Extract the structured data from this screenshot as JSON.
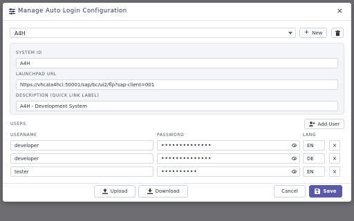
{
  "dialog": {
    "title": "Manage Auto Login Configuration",
    "close_glyph": "×",
    "menu_icon": "list-icon"
  },
  "system_select": {
    "value": "A4H"
  },
  "toolbar": {
    "new_label": "New",
    "new_glyph": "+",
    "delete_icon": "trash-icon"
  },
  "system": {
    "id_label": "SYSTEM ID",
    "id_value": "A4H",
    "url_label": "LAUNCHPAD URL",
    "url_value": "https://vhcala4hci:50001/sap/bc/ui2/flp?sap-client=001",
    "desc_label": "DESCRIPTION (QUICK LINK LABEL)",
    "desc_value": "A4H - Development System"
  },
  "users": {
    "section_label": "USERS",
    "add_label": "Add User",
    "col_username": "USERNAME",
    "col_password": "PASSWORD",
    "col_lang": "LANG",
    "rows": [
      {
        "username": "developer",
        "password": "••••••••••••••",
        "lang": "EN"
      },
      {
        "username": "developer",
        "password": "••••••••••••••",
        "lang": "DE"
      },
      {
        "username": "tester",
        "password": "••••••••••",
        "lang": "EN"
      }
    ],
    "remove_glyph": "×"
  },
  "footer": {
    "upload_label": "Upload",
    "download_label": "Download",
    "cancel_label": "Cancel",
    "save_label": "Save"
  },
  "colors": {
    "accent": "#5a5aa8",
    "panel": "#f4f5f8"
  }
}
